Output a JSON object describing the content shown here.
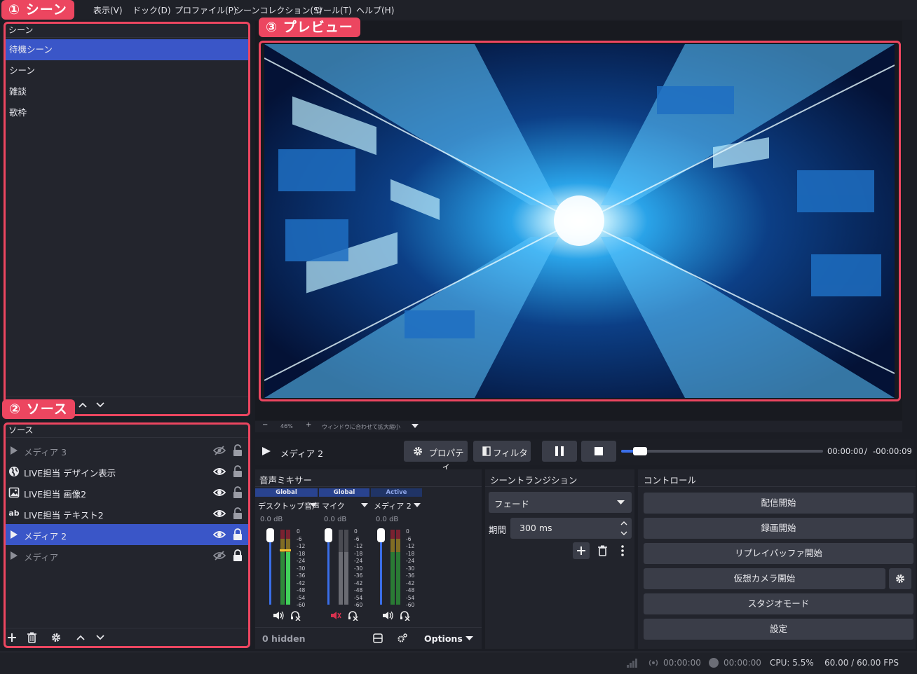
{
  "callouts": {
    "scene": "① シーン",
    "source": "② ソース",
    "preview": "③ プレビュー"
  },
  "menu": {
    "items": [
      "表示(V)",
      "ドック(D)",
      "プロファイル(P)",
      "シーンコレクション(S)",
      "ツール(T)",
      "ヘルプ(H)"
    ]
  },
  "scenes": {
    "title": "シーン",
    "items": [
      "待機シーン",
      "シーン",
      "雑談",
      "歌枠"
    ],
    "selected": "待機シーン"
  },
  "sources": {
    "title": "ソース",
    "items": [
      {
        "label": "メディア 3",
        "icon": "play-icon",
        "visible": false,
        "locked": false
      },
      {
        "label": "LIVE担当 デザイン表示",
        "icon": "globe-icon",
        "visible": true,
        "locked": false
      },
      {
        "label": "LIVE担当 画像2",
        "icon": "image-icon",
        "visible": true,
        "locked": false
      },
      {
        "label": "LIVE担当 テキスト2",
        "icon": "text-icon",
        "visible": true,
        "locked": false
      },
      {
        "label": "メディア 2",
        "icon": "play-icon",
        "visible": true,
        "locked": true
      },
      {
        "label": "メディア",
        "icon": "play-icon",
        "visible": false,
        "locked": true
      }
    ],
    "selected": "メディア 2"
  },
  "preview": {
    "zoom": "46%",
    "fit_label": "ウィンドウに合わせて拡大縮小"
  },
  "media_bar": {
    "source_name": "メディア 2",
    "properties": "プロパティ",
    "filters": "フィルタ",
    "time_current": "00:00:00",
    "separator": "/",
    "time_remaining": "-00:00:09",
    "progress": 0.03
  },
  "mixer": {
    "title": "音声ミキサー",
    "channels": [
      {
        "tab": "Global",
        "name": "デスクトップ音声",
        "db": "0.0 dB",
        "muted": false
      },
      {
        "tab": "Global",
        "name": "マイク",
        "db": "0.0 dB",
        "muted": true
      },
      {
        "tab": "Active",
        "name": "メディア 2",
        "db": "0.0 dB",
        "muted": false
      }
    ],
    "scale": [
      "0",
      "-6",
      "-12",
      "-18",
      "-24",
      "-30",
      "-36",
      "-42",
      "-48",
      "-54",
      "-60"
    ],
    "hidden": "0 hidden",
    "options": "Options"
  },
  "transition": {
    "title": "シーントランジション",
    "type": "フェード",
    "duration_label": "期間",
    "duration_value": "300 ms"
  },
  "controls": {
    "title": "コントロール",
    "buttons": [
      "配信開始",
      "録画開始",
      "リプレイバッファ開始",
      "仮想カメラ開始",
      "スタジオモード",
      "設定"
    ]
  },
  "status": {
    "stream_time": "00:00:00",
    "record_time": "00:00:00",
    "cpu": "CPU: 5.5%",
    "fps": "60.00 / 60.00 FPS"
  },
  "colors": {
    "accent": "#ec4660",
    "selection": "#3a56c8",
    "background": "#1b1d24"
  }
}
